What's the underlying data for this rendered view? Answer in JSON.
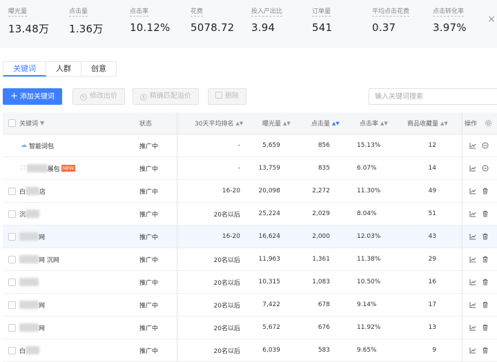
{
  "metrics": [
    {
      "label": "曝光量",
      "value": "13.48万"
    },
    {
      "label": "点击量",
      "value": "1.36万"
    },
    {
      "label": "点击率",
      "value": "10.12%"
    },
    {
      "label": "花费",
      "value": "5078.72"
    },
    {
      "label": "投入产出比",
      "value": "3.94"
    },
    {
      "label": "订单量",
      "value": "541"
    },
    {
      "label": "平均点击花费",
      "value": "0.37"
    },
    {
      "label": "点击转化率",
      "value": "3.97%"
    }
  ],
  "tabs": [
    {
      "label": "关键词",
      "active": true
    },
    {
      "label": "人群",
      "active": false
    },
    {
      "label": "创意",
      "active": false
    }
  ],
  "toolbar": {
    "add_label": "添加关键词",
    "modify_bid_label": "修改出价",
    "precise_match_label": "精确匹配溢价",
    "delete_label": "删除",
    "search_placeholder": "输入关键词搜索"
  },
  "table": {
    "headers": {
      "keyword": "关键词",
      "status": "状态",
      "rank": "30天平均排名",
      "impressions": "曝光量",
      "clicks": "点击量",
      "ctr": "点击率",
      "favorites": "商品收藏量",
      "actions": "操作"
    },
    "rows": [
      {
        "keyword_suffix": "智能词包",
        "keyword_prefix": "",
        "badge": "",
        "status": "推广中",
        "rank": "-",
        "impressions": "5,659",
        "clicks": "856",
        "ctr": "15.13%",
        "favorites": "12",
        "type": "package"
      },
      {
        "keyword_suffix": "展包",
        "keyword_prefix": "",
        "badge": "NEW",
        "status": "推广中",
        "rank": "-",
        "impressions": "13,759",
        "clicks": "835",
        "ctr": "6.07%",
        "favorites": "14",
        "type": "expand"
      },
      {
        "keyword_suffix": "店",
        "keyword_prefix": "白",
        "badge": "",
        "status": "推广中",
        "rank": "16-20",
        "impressions": "20,098",
        "clicks": "2,272",
        "ctr": "11.30%",
        "favorites": "49",
        "type": "kw"
      },
      {
        "keyword_suffix": "",
        "keyword_prefix": "沉",
        "badge": "",
        "status": "推广中",
        "rank": "20名以后",
        "impressions": "25,224",
        "clicks": "2,029",
        "ctr": "8.04%",
        "favorites": "51",
        "type": "kw"
      },
      {
        "keyword_suffix": "网",
        "keyword_prefix": "",
        "badge": "",
        "status": "推广中",
        "rank": "16-20",
        "impressions": "16,624",
        "clicks": "2,000",
        "ctr": "12.03%",
        "favorites": "43",
        "type": "kw"
      },
      {
        "keyword_suffix": "网 沉网",
        "keyword_prefix": "",
        "badge": "",
        "status": "推广中",
        "rank": "20名以后",
        "impressions": "11,963",
        "clicks": "1,361",
        "ctr": "11.38%",
        "favorites": "29",
        "type": "kw"
      },
      {
        "keyword_suffix": "",
        "keyword_prefix": "",
        "badge": "",
        "status": "推广中",
        "rank": "20名以后",
        "impressions": "10,315",
        "clicks": "1,083",
        "ctr": "10.50%",
        "favorites": "16",
        "type": "kw"
      },
      {
        "keyword_suffix": "网",
        "keyword_prefix": "",
        "badge": "",
        "status": "推广中",
        "rank": "20名以后",
        "impressions": "7,422",
        "clicks": "678",
        "ctr": "9.14%",
        "favorites": "17",
        "type": "kw"
      },
      {
        "keyword_suffix": "网",
        "keyword_prefix": "",
        "badge": "",
        "status": "推广中",
        "rank": "20名以后",
        "impressions": "5,672",
        "clicks": "676",
        "ctr": "11.92%",
        "favorites": "13",
        "type": "kw"
      },
      {
        "keyword_suffix": "",
        "keyword_prefix": "白",
        "badge": "",
        "status": "推广中",
        "rank": "20名以后",
        "impressions": "6,039",
        "clicks": "583",
        "ctr": "9.65%",
        "favorites": "9",
        "type": "kw"
      }
    ]
  },
  "colors": {
    "accent": "#3d7fff",
    "badge": "#ff6a3d"
  }
}
